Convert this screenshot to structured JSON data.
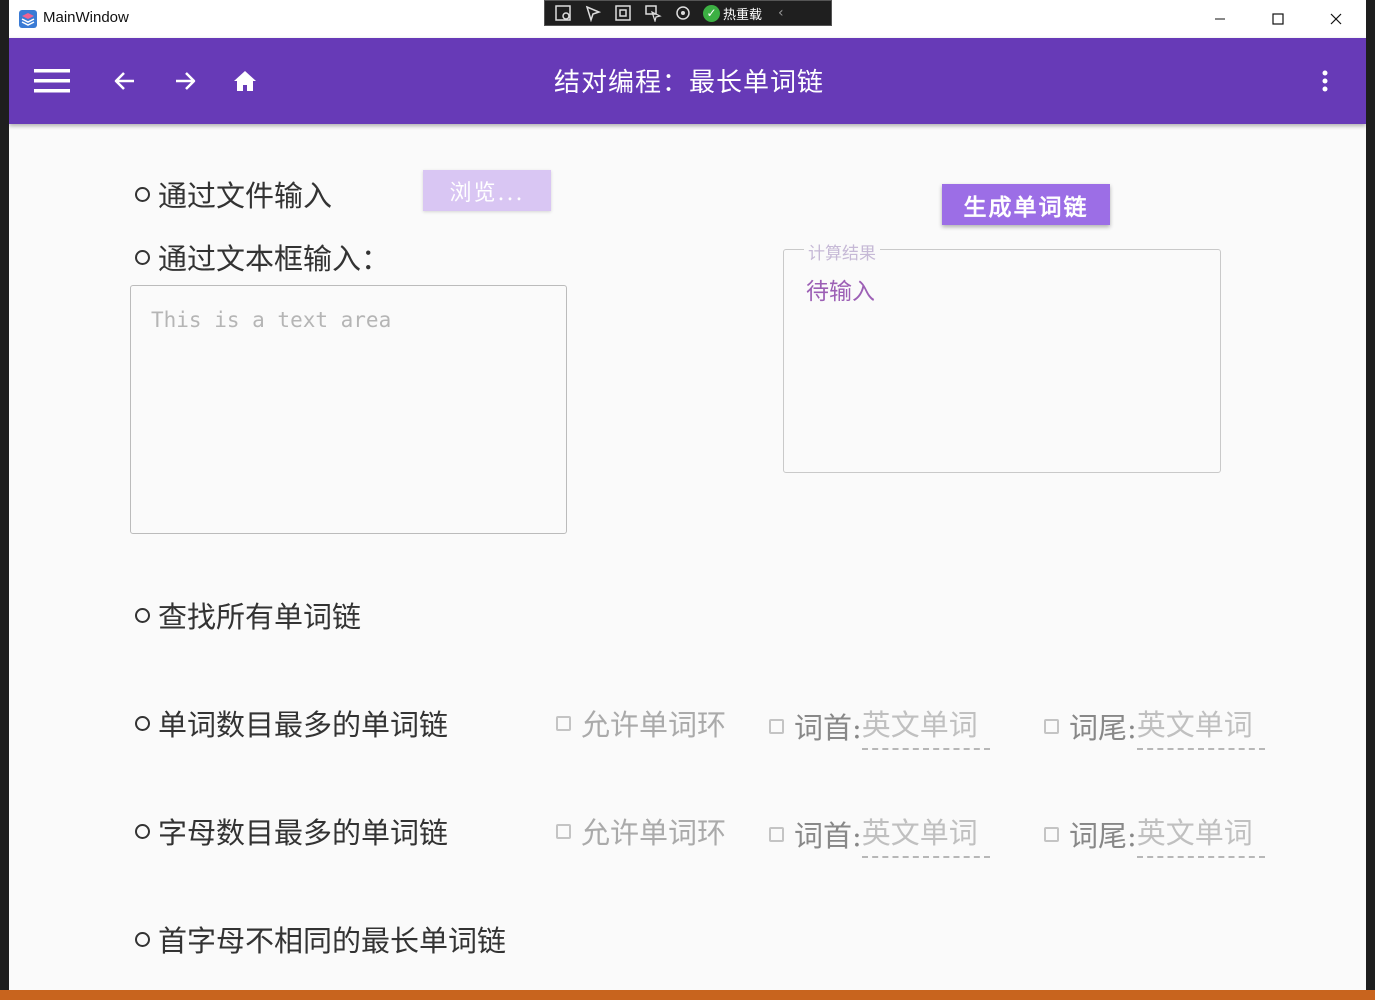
{
  "window": {
    "title": "MainWindow"
  },
  "debug_toolbar": {
    "hot_reload_label": "热重载"
  },
  "appbar": {
    "title": "结对编程：最长单词链"
  },
  "input": {
    "file_radio_label": "通过文件输入",
    "browse_label": "浏览...",
    "text_radio_label": "通过文本框输入：",
    "text_area_placeholder": "This is a text area"
  },
  "action": {
    "generate_label": "生成单词链"
  },
  "result": {
    "legend": "计算结果",
    "value": "待输入"
  },
  "modes": {
    "all_chains_label": "查找所有单词链",
    "max_words": {
      "label": "单词数目最多的单词链",
      "allow_cycle_label": "允许单词环",
      "head_label": "词首:",
      "head_placeholder": "英文单词",
      "tail_label": "词尾:",
      "tail_placeholder": "英文单词"
    },
    "max_letters": {
      "label": "字母数目最多的单词链",
      "allow_cycle_label": "允许单词环",
      "head_label": "词首:",
      "head_placeholder": "英文单词",
      "tail_label": "词尾:",
      "tail_placeholder": "英文单词"
    },
    "distinct_head_label": "首字母不相同的最长单词链"
  },
  "icons": {
    "menu": "menu-icon",
    "back": "arrow-left-icon",
    "forward": "arrow-right-icon",
    "home": "home-icon",
    "more": "more-vert-icon"
  },
  "colors": {
    "primary": "#673ab7",
    "button_accent": "#9c6ee6",
    "button_disabled": "#d9c6f3",
    "result_text": "#9c5fb5"
  }
}
